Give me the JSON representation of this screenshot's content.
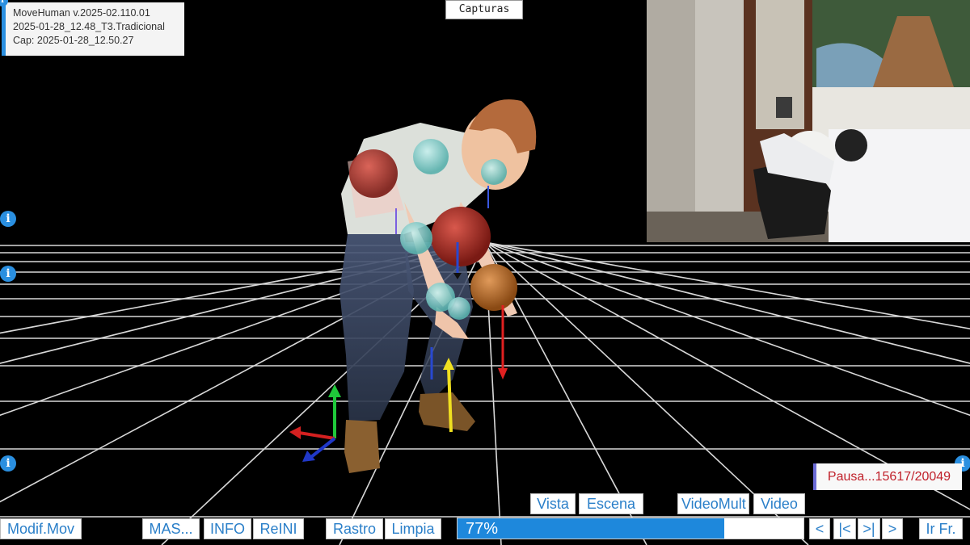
{
  "info": {
    "line1": "MoveHuman v.2025-02.110.01",
    "line2": "2025-01-28_12.48_T3.Tradicional",
    "line3": "Cap: 2025-01-28_12.50.27"
  },
  "capturas_label": "Capturas",
  "info_icon_glyph": "i",
  "view_buttons": {
    "vista": "Vista",
    "escena": "Escena",
    "videomult": "VideoMult",
    "video": "Video"
  },
  "toolbar": {
    "modif_mov": "Modif.Mov",
    "mas": "MAS...",
    "info": "INFO",
    "reini": "ReINI",
    "rastro": "Rastro",
    "limpia": "Limpia"
  },
  "progress": {
    "label": "77%",
    "value": 0.77
  },
  "status": "Pausa...15617/20049",
  "nav": {
    "prev": "<",
    "first": "|<",
    "last": ">|",
    "next": ">",
    "goto": "Ir Fr."
  },
  "colors": {
    "accent": "#2a8fe0",
    "status_text": "#c0202a",
    "grid": "#d8d8d8"
  }
}
